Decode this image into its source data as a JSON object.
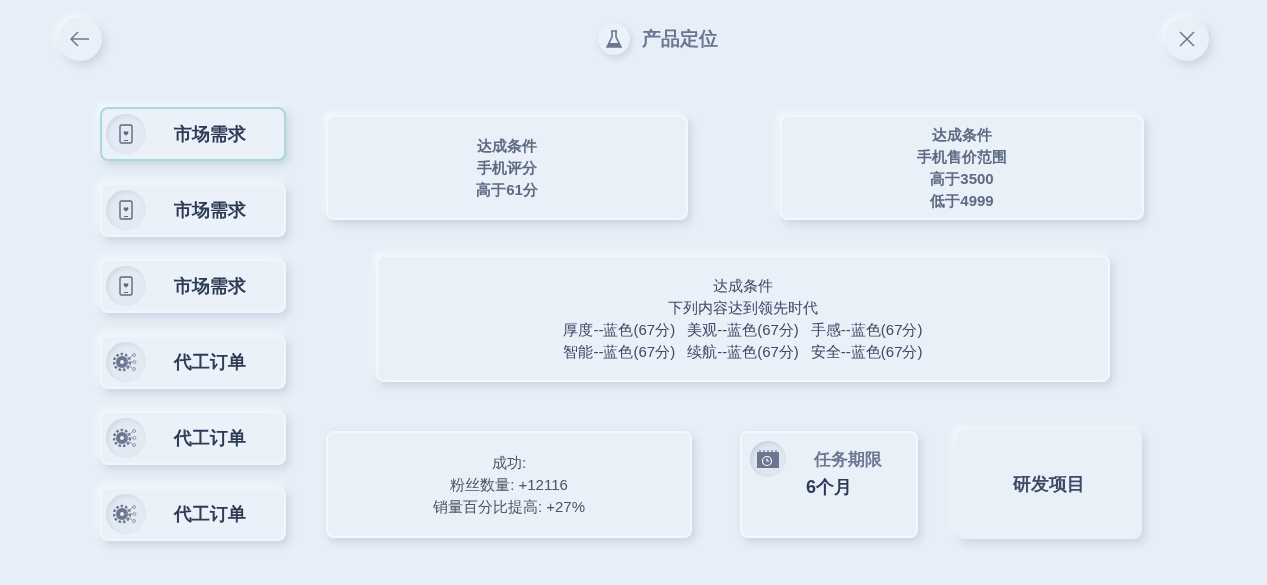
{
  "header": {
    "title": "产品定位"
  },
  "sidebar": {
    "items": [
      {
        "label": "市场需求",
        "kind": "phone",
        "selected": true
      },
      {
        "label": "市场需求",
        "kind": "phone",
        "selected": false
      },
      {
        "label": "市场需求",
        "kind": "phone",
        "selected": false
      },
      {
        "label": "代工订单",
        "kind": "gear",
        "selected": false
      },
      {
        "label": "代工订单",
        "kind": "gear",
        "selected": false
      },
      {
        "label": "代工订单",
        "kind": "gear",
        "selected": false
      }
    ]
  },
  "conditions": [
    {
      "title": "达成条件",
      "lines": [
        "手机评分",
        "高于61分"
      ]
    },
    {
      "title": "达成条件",
      "lines": [
        "手机售价范围",
        "高于3500",
        "低于4999"
      ]
    },
    {
      "title": "达成条件",
      "lines": [
        "下列内容达到领先时代"
      ],
      "items": [
        "厚度--蓝色(67分)",
        "美观--蓝色(67分)",
        "手感--蓝色(67分)",
        "智能--蓝色(67分)",
        "续航--蓝色(67分)",
        "安全--蓝色(67分)"
      ]
    }
  ],
  "reward": {
    "lines": [
      "成功:",
      "粉丝数量: +12116",
      "销量百分比提高: +27%"
    ]
  },
  "deadline": {
    "label": "任务期限",
    "value": "6个月"
  },
  "action_button": "研发项目"
}
